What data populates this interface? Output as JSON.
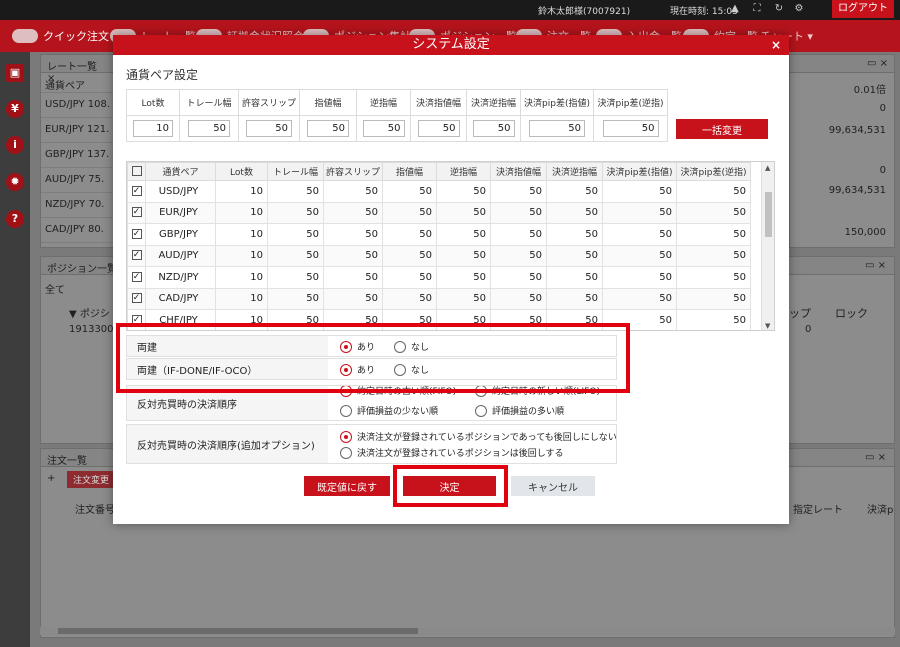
{
  "topbar": {
    "user": "鈴木太郎様(7007921)",
    "time": "現在時刻: 15:03",
    "logout": "ログアウト"
  },
  "toolbar": {
    "items": [
      "クイック注文",
      "レート一覧",
      "証拠金状況照会",
      "ポジション集計",
      "ポジション一覧",
      "注文一覧",
      "入出金一覧",
      "約定一覧",
      "チャート ▾"
    ]
  },
  "background": {
    "rate_panel_title": "レート一覧",
    "rate_col": "通貨ペア",
    "rate_rows": [
      {
        "pair": "USD/JPY",
        "val": "108."
      },
      {
        "pair": "EUR/JPY",
        "val": "121."
      },
      {
        "pair": "GBP/JPY",
        "val": "137."
      },
      {
        "pair": "AUD/JPY",
        "val": "75."
      },
      {
        "pair": "NZD/JPY",
        "val": "70."
      },
      {
        "pair": "CAD/JPY",
        "val": "80."
      }
    ],
    "right_values": [
      "0.01倍",
      "0",
      "99,634,531",
      "0",
      "99,634,531",
      "150,000"
    ],
    "position_panel_title": "ポジション一覧",
    "position_filter": "全て",
    "position_col": "▼ ポジシ",
    "position_row": "19133000",
    "position_right_col1": "ップ",
    "position_right_col2": "ロック",
    "position_right_val": "0",
    "order_panel_title": "注文一覧",
    "order_add": "+",
    "order_change": "注文変更",
    "order_col": "注文番号",
    "order_right_col1": "指定レート",
    "order_right_col2": "決済p"
  },
  "dialog": {
    "title": "システム設定",
    "close": "×",
    "section": "通貨ペア設定",
    "param_headers": [
      "Lot数",
      "トレール幅",
      "許容スリップ",
      "指値幅",
      "逆指幅",
      "決済指値幅",
      "決済逆指幅",
      "決済pip差(指値)",
      "決済pip差(逆指)"
    ],
    "param_values": [
      "10",
      "50",
      "50",
      "50",
      "50",
      "50",
      "50",
      "50",
      "50"
    ],
    "bulk_button": "一括変更",
    "pair_headers": [
      "通貨ペア",
      "Lot数",
      "トレール幅",
      "許容スリップ",
      "指値幅",
      "逆指幅",
      "決済指値幅",
      "決済逆指幅",
      "決済pip差(指値)",
      "決済pip差(逆指)"
    ],
    "pair_rows": [
      {
        "pair": "USD/JPY",
        "vals": [
          "10",
          "50",
          "50",
          "50",
          "50",
          "50",
          "50",
          "50",
          "50"
        ]
      },
      {
        "pair": "EUR/JPY",
        "vals": [
          "10",
          "50",
          "50",
          "50",
          "50",
          "50",
          "50",
          "50",
          "50"
        ]
      },
      {
        "pair": "GBP/JPY",
        "vals": [
          "10",
          "50",
          "50",
          "50",
          "50",
          "50",
          "50",
          "50",
          "50"
        ]
      },
      {
        "pair": "AUD/JPY",
        "vals": [
          "10",
          "50",
          "50",
          "50",
          "50",
          "50",
          "50",
          "50",
          "50"
        ]
      },
      {
        "pair": "NZD/JPY",
        "vals": [
          "10",
          "50",
          "50",
          "50",
          "50",
          "50",
          "50",
          "50",
          "50"
        ]
      },
      {
        "pair": "CAD/JPY",
        "vals": [
          "10",
          "50",
          "50",
          "50",
          "50",
          "50",
          "50",
          "50",
          "50"
        ]
      },
      {
        "pair": "CHF/JPY",
        "vals": [
          "10",
          "50",
          "50",
          "50",
          "50",
          "50",
          "50",
          "50",
          "50"
        ]
      }
    ],
    "ryodate": {
      "label": "両建",
      "yes": "あり",
      "no": "なし"
    },
    "ryodate_ifd": {
      "label": "両建（IF-DONE/IF-OCO）",
      "yes": "あり",
      "no": "なし"
    },
    "settle_order": {
      "label": "反対売買時の決済順序",
      "opt1": "約定日時の古い順(FIFO)",
      "opt2": "約定日時の新しい順(LIFO)",
      "opt3": "評価損益の少ない順",
      "opt4": "評価損益の多い順"
    },
    "settle_order_ext": {
      "label": "反対売買時の決済順序(追加オプション)",
      "opt1": "決済注文が登録されているポジションであっても後回しにしない",
      "opt2": "決済注文が登録されているポジションは後回しする"
    },
    "reset_button": "既定値に戻す",
    "ok_button": "決定",
    "cancel_button": "キャンセル"
  },
  "colors": {
    "accent": "#c8121b",
    "highlight": "#e00010"
  }
}
